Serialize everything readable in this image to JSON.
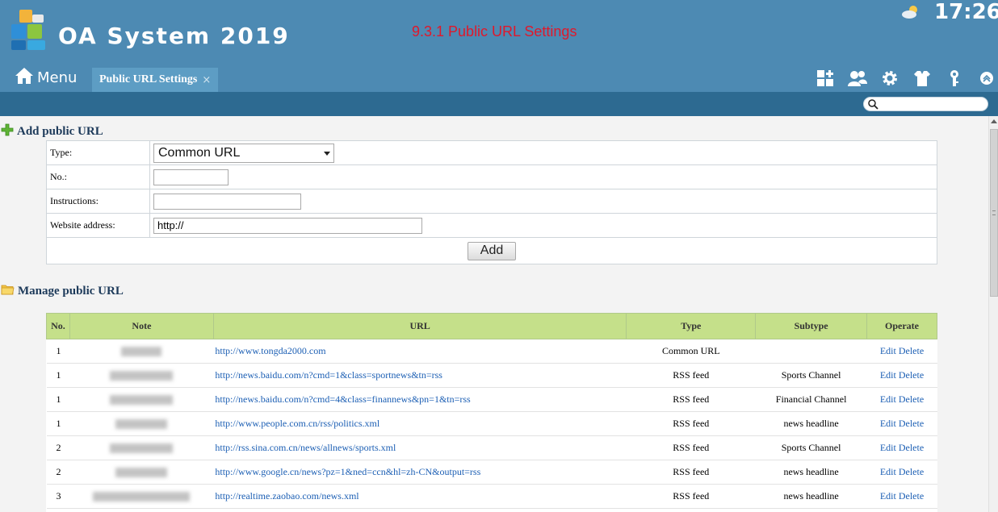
{
  "header": {
    "app_title": "OA System 2019",
    "banner_text": "9.3.1 Public URL Settings",
    "clock": "17:26"
  },
  "tabbar": {
    "menu_label": "Menu",
    "active_tab": "Public URL Settings",
    "tab_close": "×"
  },
  "add_section": {
    "title": "Add public URL",
    "type_label": "Type:",
    "type_value": "Common URL",
    "no_label": "No.:",
    "no_value": "",
    "instructions_label": "Instructions:",
    "instructions_value": "",
    "website_label": "Website address:",
    "website_value": "http://",
    "add_button": "Add"
  },
  "manage_section": {
    "title": "Manage public URL",
    "columns": [
      "No.",
      "Note",
      "URL",
      "Type",
      "Subtype",
      "Operate"
    ],
    "edit_label": "Edit",
    "delete_label": "Delete",
    "rows": [
      {
        "no": "1",
        "url": "http://www.tongda2000.com",
        "type": "Common URL",
        "subtype": ""
      },
      {
        "no": "1",
        "url": "http://news.baidu.com/n?cmd=1&class=sportnews&tn=rss",
        "type": "RSS feed",
        "subtype": "Sports Channel"
      },
      {
        "no": "1",
        "url": "http://news.baidu.com/n?cmd=4&class=finannews&pn=1&tn=rss",
        "type": "RSS feed",
        "subtype": "Financial Channel"
      },
      {
        "no": "1",
        "url": "http://www.people.com.cn/rss/politics.xml",
        "type": "RSS feed",
        "subtype": "news headline"
      },
      {
        "no": "2",
        "url": "http://rss.sina.com.cn/news/allnews/sports.xml",
        "type": "RSS feed",
        "subtype": "Sports Channel"
      },
      {
        "no": "2",
        "url": "http://www.google.cn/news?pz=1&ned=ccn&hl=zh-CN&output=rss",
        "type": "RSS feed",
        "subtype": "news headline"
      },
      {
        "no": "3",
        "url": "http://realtime.zaobao.com/news.xml",
        "type": "RSS feed",
        "subtype": "news headline"
      }
    ]
  },
  "colors": {
    "header_bg": "#4d8ab3",
    "search_strip_bg": "#2d6a91",
    "table_header_bg": "#c5e08a",
    "link": "#1c5fb4",
    "banner": "#e0182b"
  },
  "icons": [
    "logo-icon",
    "weather-icon",
    "home-icon",
    "apps-icon",
    "users-icon",
    "gear-icon",
    "shirt-icon",
    "key-icon",
    "collapse-icon",
    "search-icon",
    "plus-icon",
    "folder-icon"
  ]
}
